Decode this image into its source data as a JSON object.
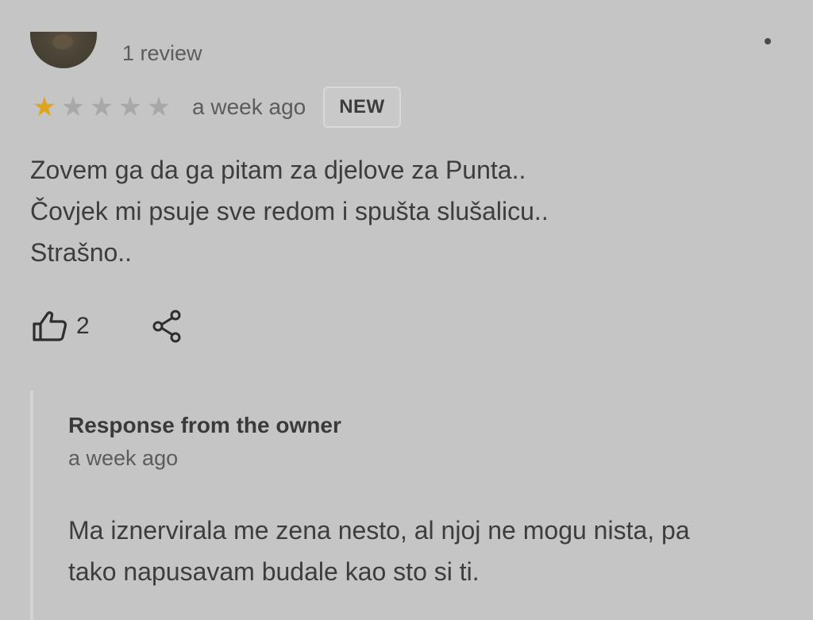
{
  "reviewer": {
    "review_count": "1 review"
  },
  "rating": {
    "stars_filled": 1,
    "stars_total": 5,
    "star_color": "#e0a41f",
    "time_ago": "a week ago",
    "badge": "NEW"
  },
  "review": {
    "lines": [
      "Zovem ga da ga pitam za djelove za Punta..",
      "Čovjek mi psuje sve redom i spušta slušalicu..",
      "Strašno.."
    ]
  },
  "actions": {
    "like_icon": "thumbs-up-icon",
    "like_count": "2",
    "share_icon": "share-icon",
    "more_icon": "more-options-icon"
  },
  "owner_response": {
    "title": "Response from the owner",
    "time_ago": "a week ago",
    "lines": [
      "Ma iznervirala me zena nesto, al njoj ne mogu nista, pa",
      "tako napusavam budale kao sto si ti."
    ]
  }
}
